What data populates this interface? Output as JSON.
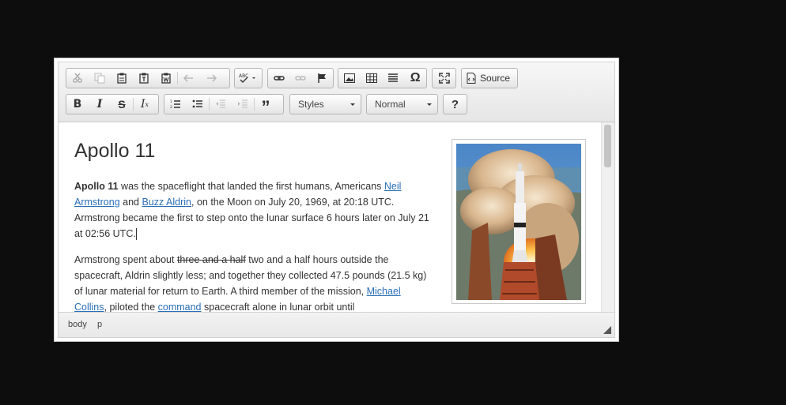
{
  "toolbar": {
    "source_label": "Source",
    "styles_label": "Styles",
    "format_label": "Normal",
    "help_label": "?"
  },
  "content": {
    "title": "Apollo 11",
    "p1": {
      "bold": "Apollo 11",
      "t1": " was the spaceflight that landed the first humans, Americans ",
      "link1": "Neil Armstrong",
      "t2": " and ",
      "link2": "Buzz Aldrin",
      "t3": ", on the Moon on July 20, 1969, at 20:18 UTC. Armstrong became the first to step onto the lunar surface 6 hours later on July 21 at 02:56 UTC."
    },
    "p2": {
      "t1": "Armstrong spent about ",
      "strike": "three and a half",
      "t2": " two and a half hours outside the spacecraft, Aldrin slightly less; and together they collected 47.5 pounds (21.5 kg) of lunar material for return to Earth. A third member of the mission, ",
      "link1": "Michael Collins",
      "t3": ", piloted the ",
      "link2": "command",
      "t4": " spacecraft alone in lunar orbit until"
    }
  },
  "status": {
    "path": [
      "body",
      "p"
    ]
  },
  "colors": {
    "link": "#2a6fb6",
    "background": "#0d0d0d"
  }
}
